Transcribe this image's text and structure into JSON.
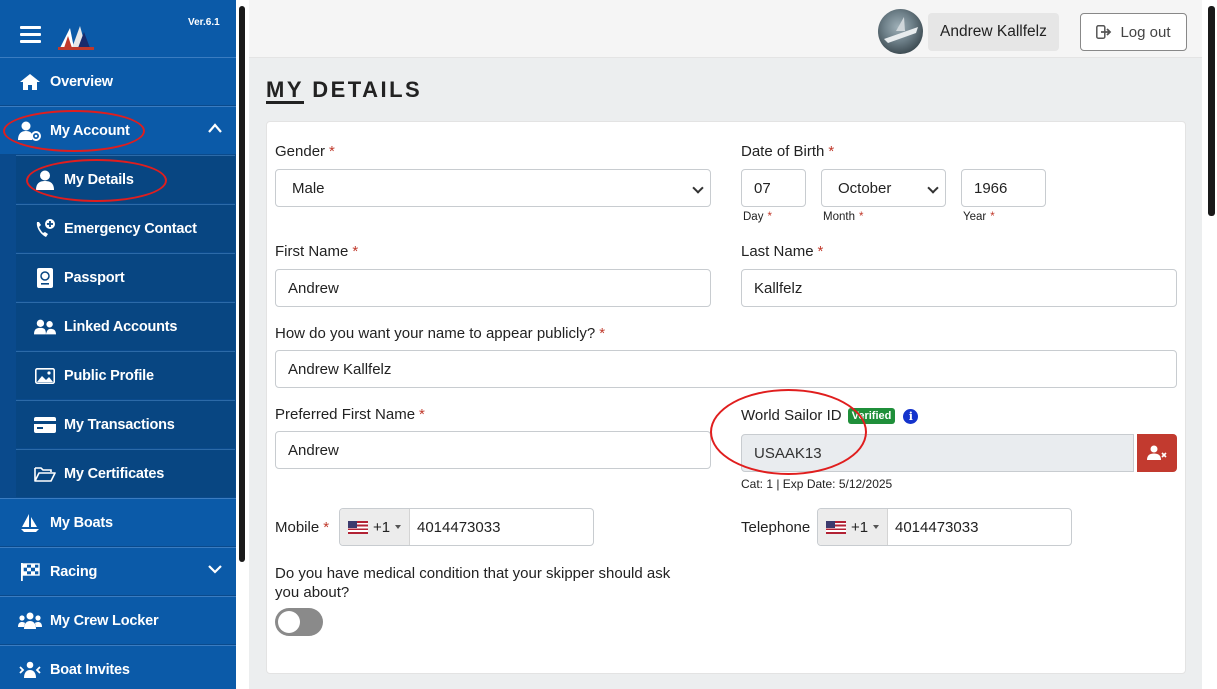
{
  "sidebar": {
    "version": "Ver.6.1",
    "items": [
      {
        "label": "Overview",
        "icon": "home-icon"
      },
      {
        "label": "My Account",
        "icon": "user-gear-icon"
      },
      {
        "label": "My Boats",
        "icon": "sailboat-icon"
      },
      {
        "label": "Racing",
        "icon": "checkered-flag-icon"
      },
      {
        "label": "My Crew Locker",
        "icon": "users-icon"
      },
      {
        "label": "Boat Invites",
        "icon": "invite-icon"
      }
    ],
    "sub_items": [
      {
        "label": "My Details",
        "icon": "user-icon"
      },
      {
        "label": "Emergency Contact",
        "icon": "phone-plus-icon"
      },
      {
        "label": "Passport",
        "icon": "passport-icon"
      },
      {
        "label": "Linked Accounts",
        "icon": "linked-users-icon"
      },
      {
        "label": "Public Profile",
        "icon": "image-icon"
      },
      {
        "label": "My Transactions",
        "icon": "credit-card-icon"
      },
      {
        "label": "My Certificates",
        "icon": "folder-open-icon"
      }
    ]
  },
  "header": {
    "user_name": "Andrew Kallfelz",
    "logout_label": "Log out"
  },
  "page": {
    "title": "MY DETAILS"
  },
  "form": {
    "gender": {
      "label": "Gender",
      "value": "Male"
    },
    "dob": {
      "label": "Date of Birth",
      "day": "07",
      "month": "October",
      "year": "1966",
      "day_label": "Day",
      "month_label": "Month",
      "year_label": "Year"
    },
    "first_name": {
      "label": "First Name",
      "value": "Andrew"
    },
    "last_name": {
      "label": "Last Name",
      "value": "Kallfelz"
    },
    "public_name": {
      "label": "How do you want your name to appear publicly?",
      "value": "Andrew Kallfelz"
    },
    "preferred_first_name": {
      "label": "Preferred First Name",
      "value": "Andrew"
    },
    "world_sailor": {
      "label": "World Sailor ID",
      "badge": "Verified",
      "info": "i",
      "value": "USAAK13",
      "meta": "Cat: 1 | Exp Date: 5/12/2025"
    },
    "mobile": {
      "label": "Mobile",
      "code": "+1",
      "value": "4014473033"
    },
    "telephone": {
      "label": "Telephone",
      "code": "+1",
      "value": "4014473033"
    },
    "medical": {
      "label_line1": "Do you have medical condition that your skipper should ask",
      "label_line2": "you about?",
      "enabled": false
    },
    "required_mark": "*"
  },
  "colors": {
    "sidebar": "#0b5aa8",
    "sidebar_sub": "#084682",
    "verified": "#1f8f3a",
    "danger": "#c23a2f",
    "annotation": "#e01e1e"
  }
}
